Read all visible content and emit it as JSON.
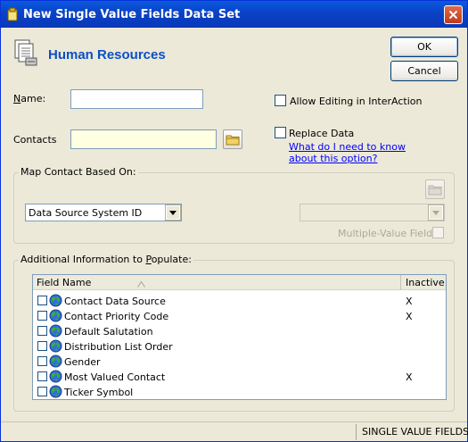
{
  "window": {
    "title": "New Single Value Fields Data Set"
  },
  "header": {
    "title": "Human Resources"
  },
  "buttons": {
    "ok": "OK",
    "cancel": "Cancel"
  },
  "form": {
    "name_label": "Name:",
    "name_value": "",
    "contacts_label": "Contacts",
    "contacts_value": "",
    "allow_editing_label": "Allow Editing in InterAction",
    "allow_editing_checked": false,
    "replace_data_label": "Replace Data",
    "replace_data_checked": false,
    "help_link_line1": "What do I need to know",
    "help_link_line2": "about this option?"
  },
  "map_group": {
    "title": "Map Contact Based On:",
    "combo_value": "Data Source System ID",
    "second_combo_value": "",
    "multiple_value_label": "Multiple-Value Fields",
    "multiple_value_checked": false
  },
  "additional_group": {
    "title": "Additional Information to Populate:",
    "columns": {
      "field_name": "Field Name",
      "inactive": "Inactive"
    },
    "rows": [
      {
        "name": "Contact Data Source",
        "inactive": "X",
        "checked": false
      },
      {
        "name": "Contact Priority Code",
        "inactive": "X",
        "checked": false
      },
      {
        "name": "Default Salutation",
        "inactive": "",
        "checked": false
      },
      {
        "name": "Distribution List Order",
        "inactive": "",
        "checked": false
      },
      {
        "name": "Gender",
        "inactive": "",
        "checked": false
      },
      {
        "name": "Most Valued Contact",
        "inactive": "X",
        "checked": false
      },
      {
        "name": "Ticker Symbol",
        "inactive": "",
        "checked": false
      }
    ]
  },
  "status_bar": {
    "text": "SINGLE VALUE FIELDS"
  },
  "icons": {
    "title": "app-icon",
    "header": "document-stack-icon",
    "folder": "folder-icon",
    "row": "globe-icon",
    "sort": "sort-arrow-icon",
    "close": "close-icon"
  },
  "colors": {
    "title_bar": "#0a48cc",
    "header_title": "#0a50c8",
    "link": "#0000ff",
    "window_bg": "#ece9d8"
  }
}
